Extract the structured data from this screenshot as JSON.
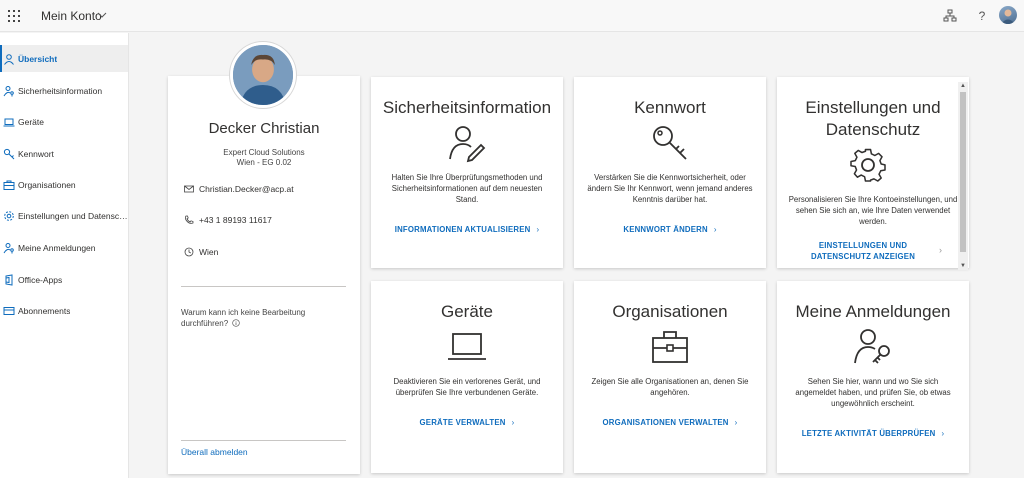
{
  "topbar": {
    "app_title": "Mein Konto",
    "icons": [
      "app-launcher-icon",
      "org-chart-icon",
      "help-icon",
      "user-avatar"
    ],
    "help_label": "?"
  },
  "sidebar": {
    "items": [
      {
        "label": "Übersicht",
        "icon": "person-icon",
        "active": true
      },
      {
        "label": "Sicherheitsinformation",
        "icon": "person-key-icon"
      },
      {
        "label": "Geräte",
        "icon": "laptop-icon"
      },
      {
        "label": "Kennwort",
        "icon": "key-icon"
      },
      {
        "label": "Organisationen",
        "icon": "briefcase-icon"
      },
      {
        "label": "Einstellungen und Datenschutz",
        "icon": "gear-icon"
      },
      {
        "label": "Meine Anmeldungen",
        "icon": "person-key-icon"
      },
      {
        "label": "Office-Apps",
        "icon": "office-icon"
      },
      {
        "label": "Abonnements",
        "icon": "card-icon"
      }
    ]
  },
  "profile": {
    "name": "Decker Christian",
    "company": "Expert Cloud Solutions",
    "office": "Wien - EG 0.02",
    "email": "Christian.Decker@acp.at",
    "phone": "+43 1 89193 11617",
    "location": "Wien",
    "question": "Warum kann ich keine Bearbeitung durchführen?",
    "sign_out": "Überall abmelden"
  },
  "tiles": [
    {
      "title": "Sicherheitsinformation",
      "icon": "person-pen-icon",
      "desc": "Halten Sie Ihre Überprüfungsmethoden und Sicherheitsinformationen auf dem neuesten Stand.",
      "link": "INFORMATIONEN AKTUALISIEREN"
    },
    {
      "title": "Kennwort",
      "icon": "key-icon",
      "desc": "Verstärken Sie die Kennwortsicherheit, oder ändern Sie Ihr Kennwort, wenn jemand anderes Kenntnis darüber hat.",
      "link": "KENNWORT ÄNDERN"
    },
    {
      "title": "Einstellungen und Datenschutz",
      "icon": "gear-icon",
      "desc": "Personalisieren Sie Ihre Kontoeinstellungen, und sehen Sie sich an, wie Ihre Daten verwendet werden.",
      "link": "EINSTELLUNGEN UND DATENSCHUTZ ANZEIGEN"
    },
    {
      "title": "Geräte",
      "icon": "laptop-icon",
      "desc": "Deaktivieren Sie ein verlorenes Gerät, und überprüfen Sie Ihre verbundenen Geräte.",
      "link": "GERÄTE VERWALTEN"
    },
    {
      "title": "Organisationen",
      "icon": "briefcase-icon",
      "desc": "Zeigen Sie alle Organisationen an, denen Sie angehören.",
      "link": "ORGANISATIONEN VERWALTEN"
    },
    {
      "title": "Meine Anmeldungen",
      "icon": "person-key-icon",
      "desc": "Sehen Sie hier, wann und wo Sie sich angemeldet haben, und prüfen Sie, ob etwas ungewöhnlich erscheint.",
      "link": "LETZTE AKTIVITÄT ÜBERPRÜFEN"
    }
  ],
  "colors": {
    "accent": "#0f6cbd",
    "background": "#f4f4f4",
    "text": "#323130"
  }
}
